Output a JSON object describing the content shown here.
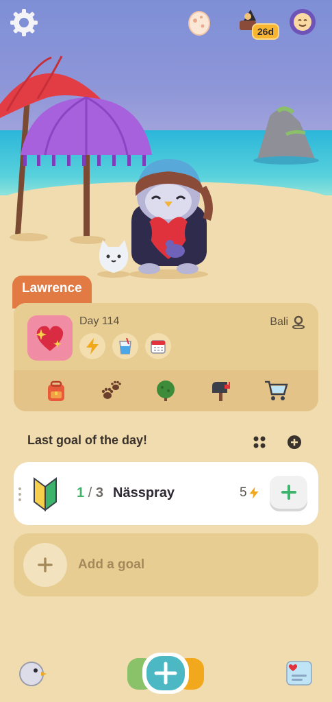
{
  "profile": {
    "name": "Lawrence",
    "day": "Day 114",
    "location": "Bali"
  },
  "header": {
    "streak": "26d"
  },
  "goals": {
    "section_title": "Last goal of the day!",
    "items": [
      {
        "completed": "1",
        "separator": "/",
        "total": "3",
        "name": "Nässpray",
        "energy": "5"
      }
    ],
    "add_label": "Add a goal"
  },
  "icons": {
    "header": [
      "gear-icon",
      "egg-icon",
      "streak-icon",
      "mood-icon"
    ],
    "badges": [
      "lightning-icon",
      "water-glass-icon",
      "calendar-icon"
    ],
    "nav": [
      "backpack-icon",
      "paw-prints-icon",
      "tree-icon",
      "mailbox-icon",
      "shopping-cart-icon"
    ],
    "bottom": [
      "bird-icon",
      "add-icon",
      "journal-icon"
    ]
  },
  "colors": {
    "background": "#f0dcae",
    "card": "#e8cd93",
    "name_tag": "#e27a43",
    "accent_green": "#3db36b",
    "accent_teal": "#4bb8c4",
    "heart_tile": "#f08ca4",
    "energy": "#f2a81d"
  }
}
